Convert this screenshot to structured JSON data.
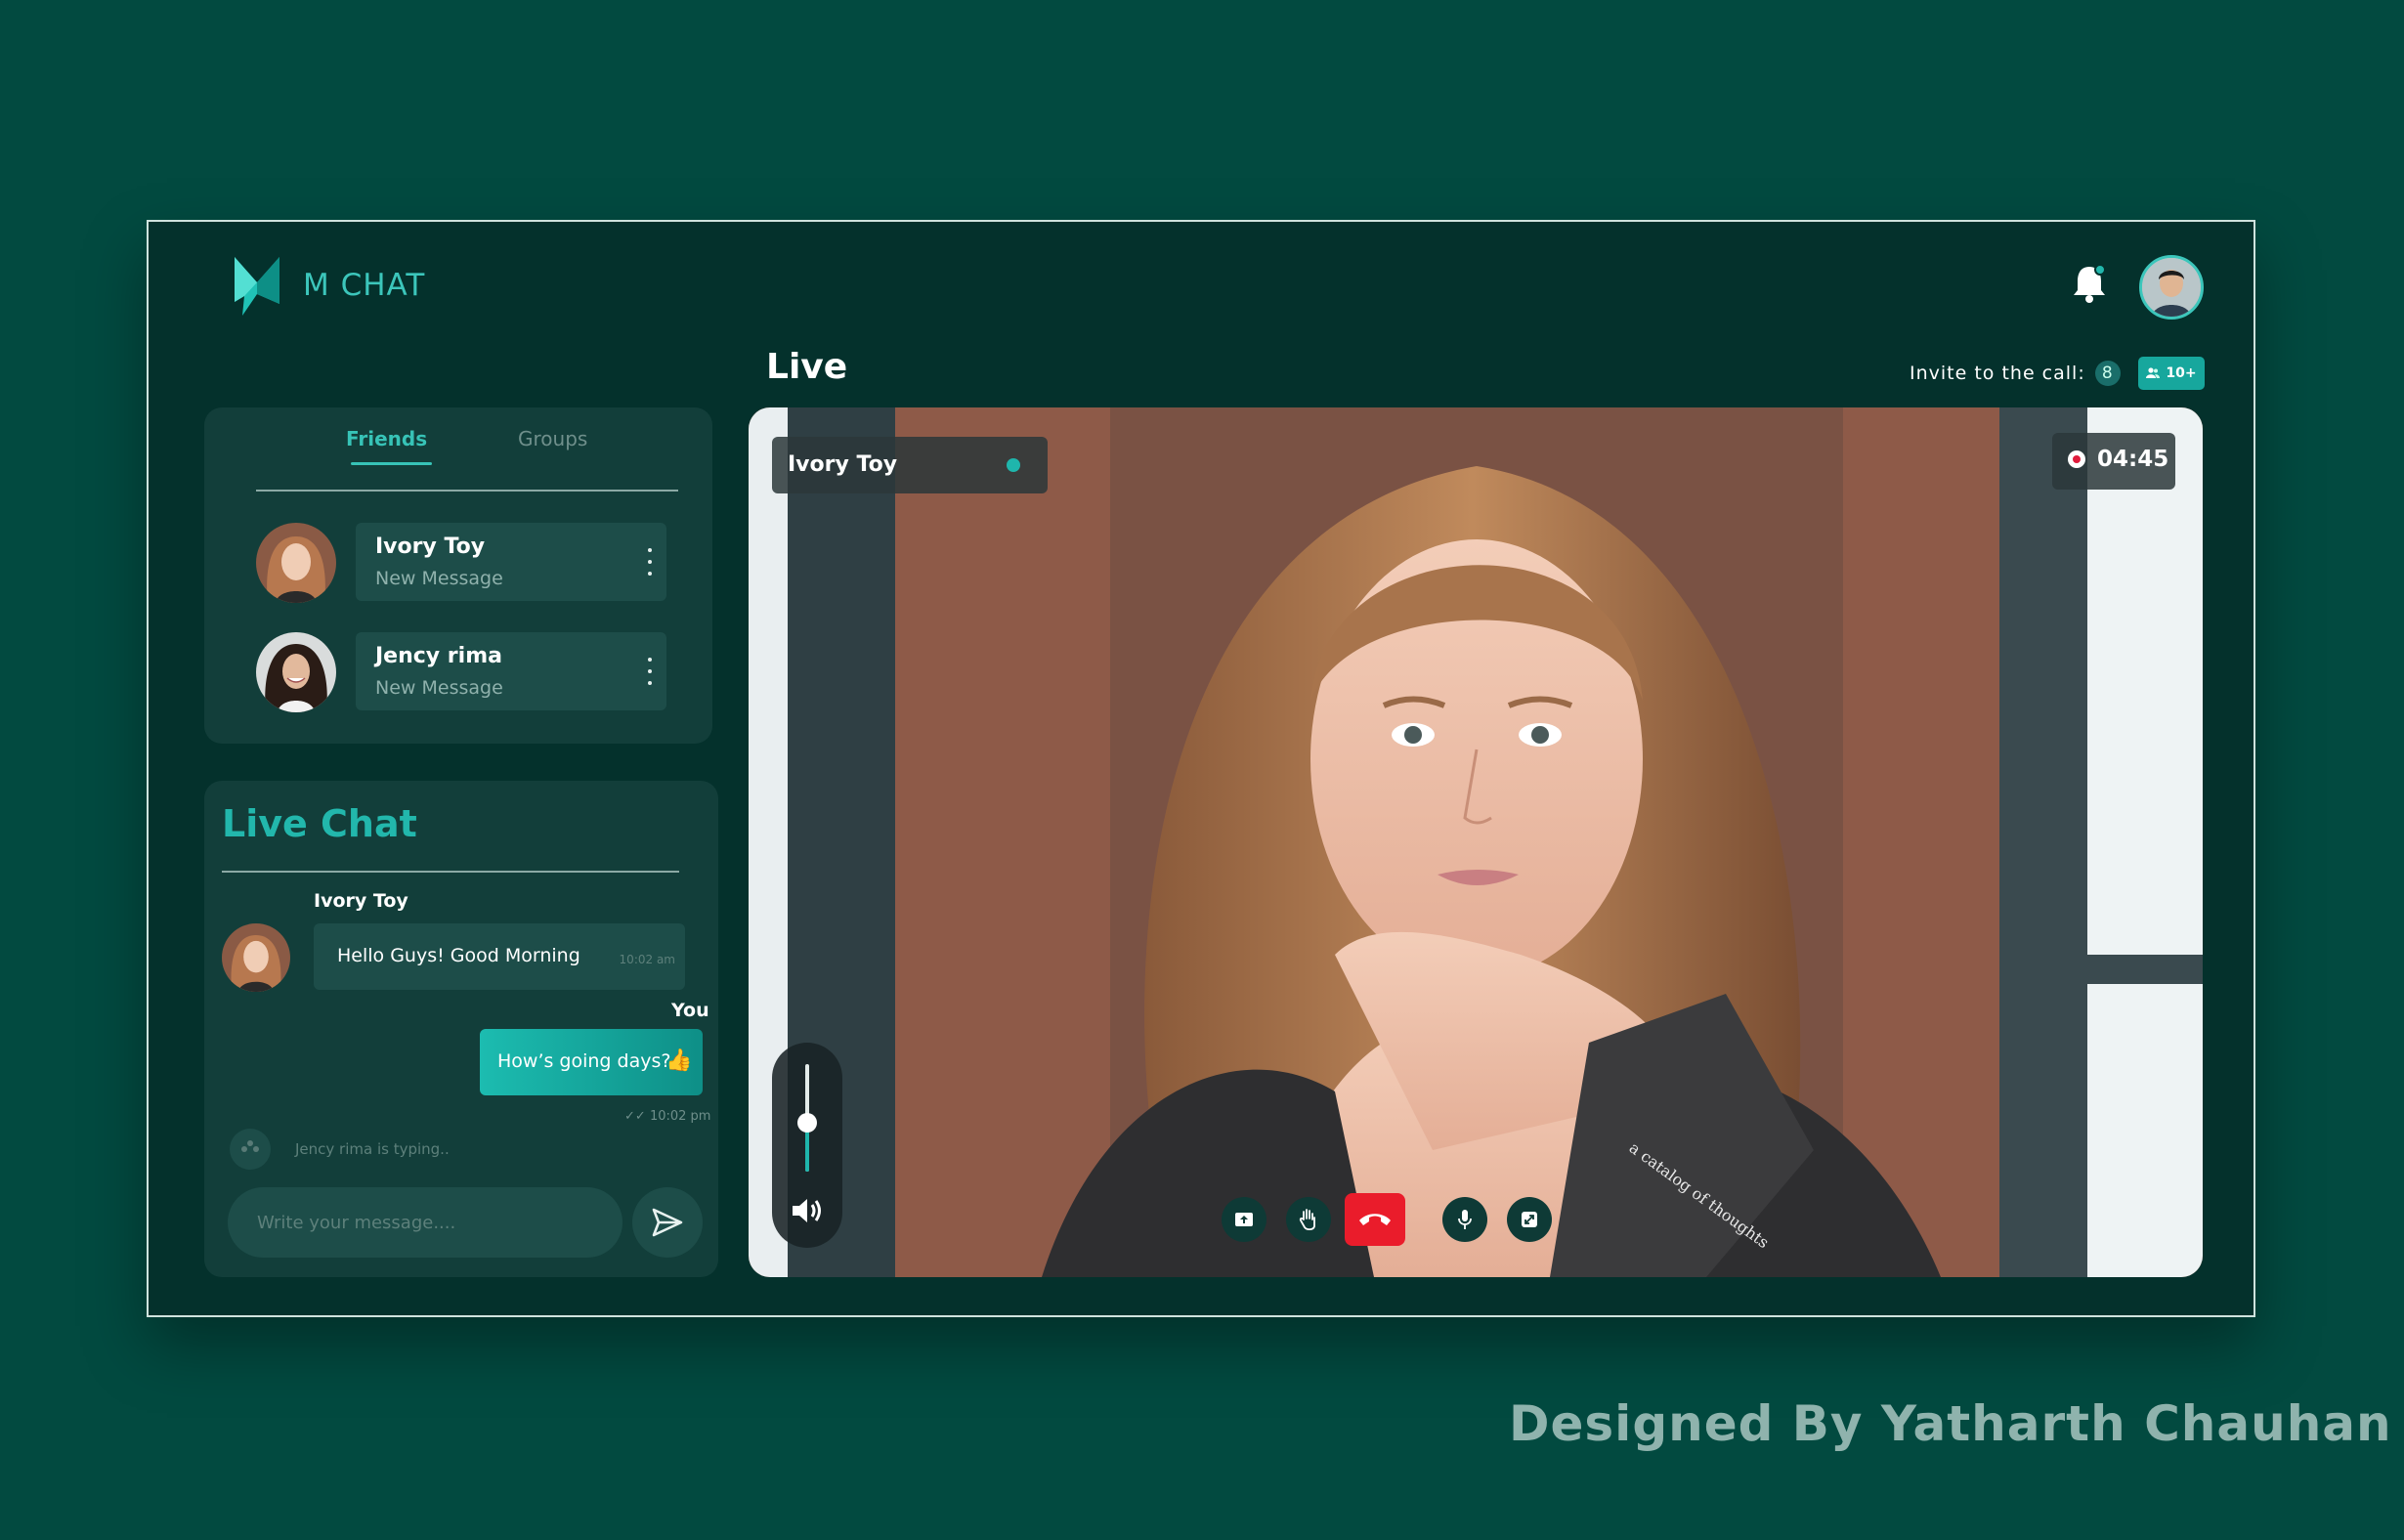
{
  "app": {
    "name": "M CHAT"
  },
  "header": {
    "notification_icon": "bell-icon",
    "user_avatar": "avatar"
  },
  "live": {
    "title": "Live",
    "invite_label": "Invite to the call:",
    "invite_count": "8",
    "participants_badge": "10+"
  },
  "friends_panel": {
    "tabs": [
      {
        "label": "Friends",
        "active": true
      },
      {
        "label": "Groups",
        "active": false
      }
    ],
    "items": [
      {
        "name": "Ivory Toy",
        "subtitle": "New Message"
      },
      {
        "name": "Jency rima",
        "subtitle": "New Message"
      }
    ]
  },
  "live_chat": {
    "title": "Live Chat",
    "messages": [
      {
        "sender": "Ivory Toy",
        "text": "Hello Guys!  Good Morning",
        "time": "10:02 am"
      },
      {
        "sender": "You",
        "text": "How’s going days?",
        "emoji": "👍",
        "time": "10:02 pm"
      }
    ],
    "typing_status": "Jency rima is typing..",
    "input_placeholder": "Write your message...."
  },
  "video": {
    "caller_name": "Ivory Toy",
    "recording_time": "04:45",
    "volume_level": 0.45,
    "book_text": "a catalog of thoughts",
    "controls": [
      "screen-share-icon",
      "raise-hand-icon",
      "end-call-icon",
      "microphone-icon",
      "fullscreen-icon"
    ]
  },
  "colors": {
    "background": "#024a40",
    "panel": "#04312c",
    "accent": "#22b7ac",
    "end_call": "#ea1c2b"
  },
  "credit": "Designed By Yatharth Chauhan"
}
